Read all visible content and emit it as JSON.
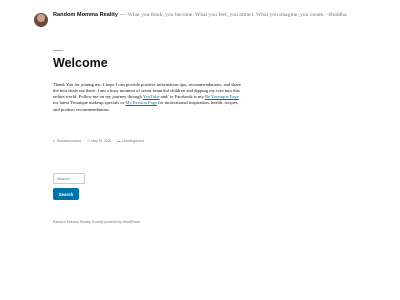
{
  "header": {
    "site_title": "Random Momma Reality",
    "separator": "—",
    "tagline": "What you think, you become. What you feel, you attract. What you imagine, you create. ~Buddha"
  },
  "post": {
    "title": "Welcome",
    "content_part1": "Thank You for joining me. I hope I can provide positive information tips, recommendations, and share the best deals out there. I am a busy momma of seven beautiful children and dipping my toes into this online world. Follow me on my journey through ",
    "link_youtube": "YouTube",
    "content_part2": " and/ or Facebook is my ",
    "link_younique": "Be Younique Page",
    "content_part3": " for latest Younique makeup specials or ",
    "link_passion": "My Passion Page",
    "content_part4": " for motivational inspiration, health, recipes, and product recommendations.",
    "meta": {
      "author": "Randommomma",
      "date": "May 16, 2020",
      "category": "Uncategorized",
      "author_icon": "person-icon",
      "date_icon": "clock-icon",
      "category_icon": "folder-icon"
    }
  },
  "search": {
    "placeholder": "Search …",
    "button_label": "Search"
  },
  "footer": {
    "text": "Random Momma Reality, Proudly powered by WordPress."
  }
}
